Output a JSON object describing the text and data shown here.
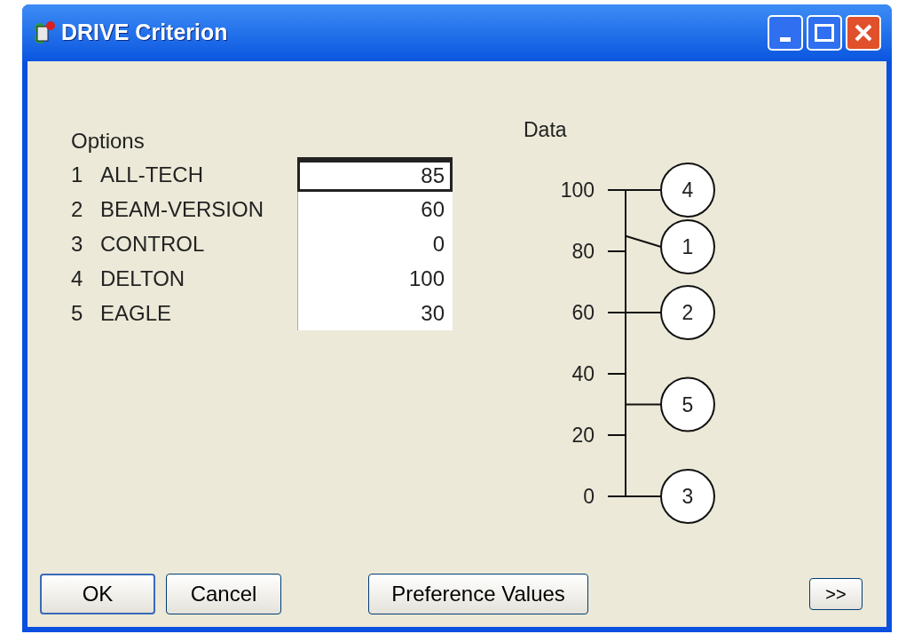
{
  "window": {
    "title": "DRIVE Criterion"
  },
  "options": {
    "label": "Options",
    "rows": [
      {
        "number": "1",
        "name": "ALL-TECH",
        "value": "85",
        "selected": true
      },
      {
        "number": "2",
        "name": "BEAM-VERSION",
        "value": "60",
        "selected": false
      },
      {
        "number": "3",
        "name": "CONTROL",
        "value": "0",
        "selected": false
      },
      {
        "number": "4",
        "name": "DELTON",
        "value": "100",
        "selected": false
      },
      {
        "number": "5",
        "name": "EAGLE",
        "value": "30",
        "selected": false
      }
    ]
  },
  "data_panel": {
    "title": "Data",
    "ticks": [
      "100",
      "80",
      "60",
      "40",
      "20",
      "0"
    ],
    "markers": [
      {
        "label": "4",
        "level": 1
      },
      {
        "label": "1",
        "level": 0.85
      },
      {
        "label": "2",
        "level": 0.6
      },
      {
        "label": "5",
        "level": 0.3
      },
      {
        "label": "3",
        "level": 0
      }
    ]
  },
  "buttons": [
    "OK",
    "Cancel",
    "Preference Values",
    ">>"
  ]
}
